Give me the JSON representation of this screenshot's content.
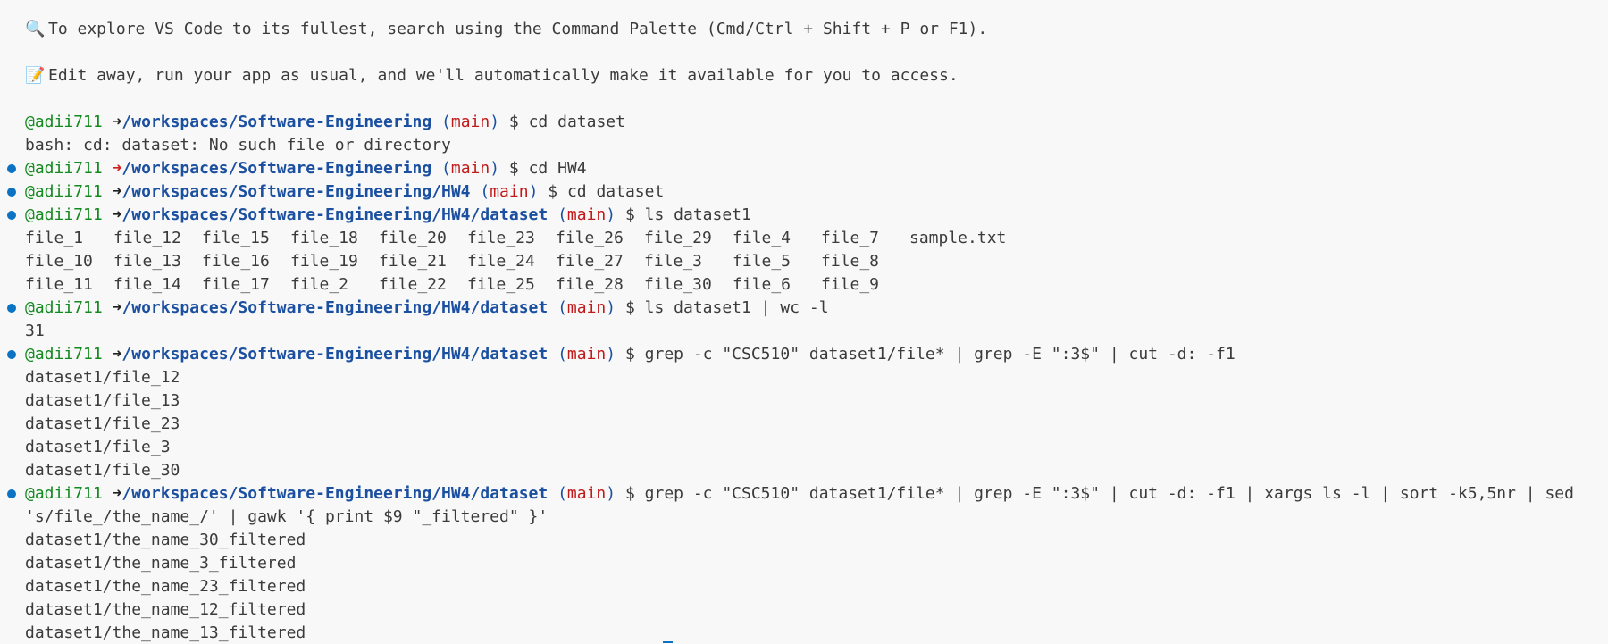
{
  "tips": {
    "explore_icon": "🔍",
    "explore_text": "To explore VS Code to its fullest, search using the Command Palette (Cmd/Ctrl + Shift + P or F1).",
    "edit_icon": "📝",
    "edit_text": "Edit away, run your app as usual, and we'll automatically make it available for you to access."
  },
  "prompt": {
    "user": "@adii711",
    "arrow": "➜",
    "branch": "main",
    "open_paren": "(",
    "close_paren": ")",
    "dollar": "$",
    "cwd_root": "/workspaces/Software-Engineering",
    "cwd_hw4": "/workspaces/Software-Engineering/HW4",
    "cwd_dataset": "/workspaces/Software-Engineering/HW4/dataset"
  },
  "commands": {
    "cmd1": "cd dataset",
    "out1": "bash: cd: dataset: No such file or directory",
    "cmd2": "cd HW4",
    "cmd3": "cd dataset",
    "cmd4": "ls dataset1",
    "cmd5": "ls dataset1 | wc -l",
    "out5": "31",
    "cmd6": "grep -c \"CSC510\" dataset1/file* | grep -E \":3$\" | cut -d: -f1",
    "cmd7": "grep -c \"CSC510\" dataset1/file* | grep -E \":3$\" | cut -d: -f1 | xargs ls -l | sort -k5,5nr | sed",
    "cmd7_cont": "'s/file_/the_name_/' | gawk '{ print $9 \"_filtered\" }'"
  },
  "ls_output": [
    [
      "file_1",
      "file_12",
      "file_15",
      "file_18",
      "file_20",
      "file_23",
      "file_26",
      "file_29",
      "file_4",
      "file_7",
      "sample.txt"
    ],
    [
      "file_10",
      "file_13",
      "file_16",
      "file_19",
      "file_21",
      "file_24",
      "file_27",
      "file_3",
      "file_5",
      "file_8"
    ],
    [
      "file_11",
      "file_14",
      "file_17",
      "file_2",
      "file_22",
      "file_25",
      "file_28",
      "file_30",
      "file_6",
      "file_9"
    ]
  ],
  "grep_output": [
    "dataset1/file_12",
    "dataset1/file_13",
    "dataset1/file_23",
    "dataset1/file_3",
    "dataset1/file_30"
  ],
  "filtered_output": [
    "dataset1/the_name_30_filtered",
    "dataset1/the_name_3_filtered",
    "dataset1/the_name_23_filtered",
    "dataset1/the_name_12_filtered",
    "dataset1/the_name_13_filtered"
  ],
  "colors": {
    "background": "#f8f8f8",
    "user": "#138a1f",
    "cwd": "#1b4fa0",
    "branch": "#c21a1a",
    "error_arrow": "#d21d1d",
    "decoration_dot": "#0b72c4"
  }
}
